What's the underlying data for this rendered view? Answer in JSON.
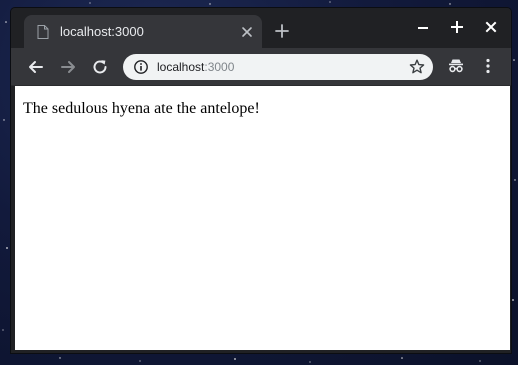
{
  "browser": {
    "tab": {
      "title": "localhost:3000",
      "icon": "page-icon",
      "close_icon": "close-icon"
    },
    "new_tab_icon": "plus-icon",
    "window_controls": [
      "minimize-icon",
      "maximize-icon",
      "close-icon"
    ],
    "toolbar": {
      "back_icon": "arrow-left-icon",
      "forward_icon": "arrow-right-icon",
      "reload_icon": "reload-icon",
      "omnibox": {
        "host": "localhost",
        "port": ":3000",
        "info_icon": "info-icon",
        "bookmark_icon": "star-icon"
      },
      "incognito_icon": "incognito-icon",
      "menu_icon": "more-vertical-icon"
    }
  },
  "page": {
    "text": "The sedulous hyena ate the antelope!"
  },
  "colors": {
    "frame": "#202124",
    "toolbar": "#35363a",
    "omnibox": "#f1f3f4",
    "desktop": "#121a3c"
  }
}
